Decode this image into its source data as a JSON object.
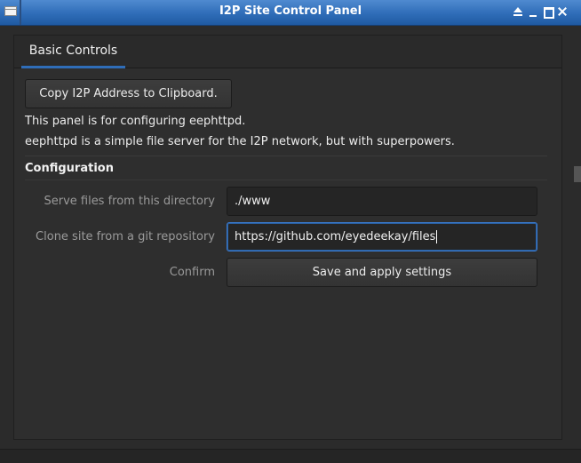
{
  "window": {
    "title": "I2P Site Control Panel"
  },
  "tabs": [
    {
      "label": "Basic Controls"
    }
  ],
  "basic_controls": {
    "copy_button": "Copy I2P Address to Clipboard.",
    "info_line_1": "This panel is for configuring eephttpd.",
    "info_line_2": "eephttpd is a simple file server for the I2P network, but with superpowers.",
    "section_title": "Configuration",
    "serve_dir": {
      "label": "Serve files from this directory",
      "value": "./www"
    },
    "git_repo": {
      "label": "Clone site from a git repository",
      "value": "https://github.com/eyedeekay/files"
    },
    "confirm": {
      "label": "Confirm",
      "button": "Save and apply settings"
    }
  },
  "colors": {
    "titlebar": "#2f6db8",
    "window_bg": "#2b2b2b",
    "focus_border": "#3b7bd0"
  },
  "icons": [
    "window-menu-icon",
    "shade-icon",
    "minimize-icon",
    "maximize-icon",
    "close-icon"
  ]
}
